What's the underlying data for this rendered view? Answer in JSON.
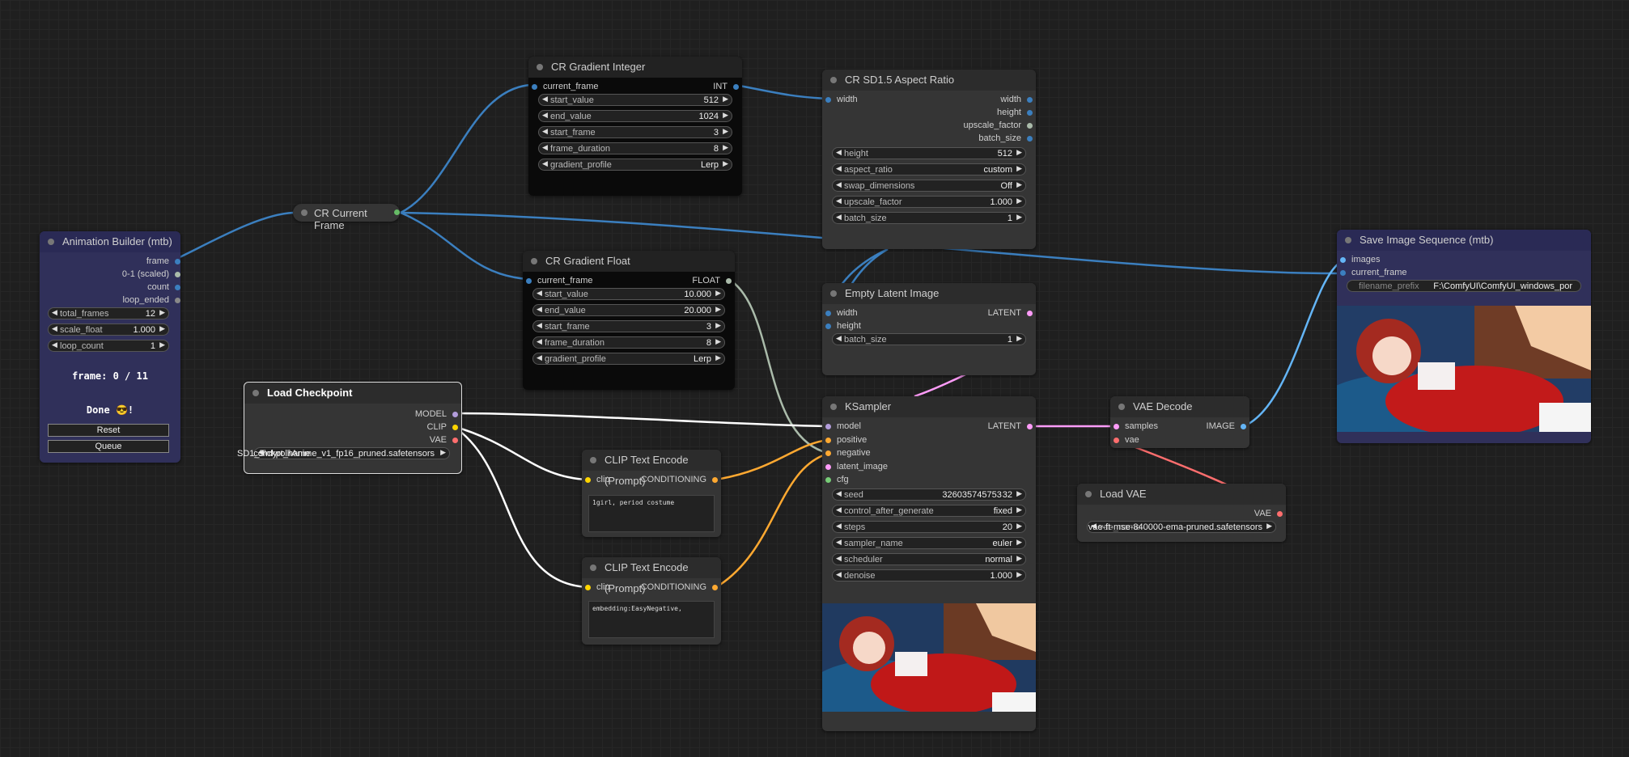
{
  "colors": {
    "model": "#b39ddb",
    "clip": "#ffd500",
    "vae": "#ff6e6e",
    "latent": "#ff9cf9",
    "conditioning": "#ffa931",
    "image": "#64b5f6",
    "int": "#3b7fbf",
    "float": "#aabbaa"
  },
  "anim": {
    "title": "Animation Builder (mtb)",
    "outputs": [
      "frame",
      "0-1 (scaled)",
      "count",
      "loop_ended"
    ],
    "widgets": [
      {
        "label": "total_frames",
        "value": "12"
      },
      {
        "label": "scale_float",
        "value": "1.000"
      },
      {
        "label": "loop_count",
        "value": "1"
      }
    ],
    "frame_text": "frame: 0 / 11",
    "done_text": "Done 😎!",
    "reset": "Reset",
    "queue": "Queue"
  },
  "current_frame": {
    "title": "CR Current Frame"
  },
  "grad_int": {
    "title": "CR Gradient Integer",
    "input": "current_frame",
    "output": "INT",
    "widgets": [
      {
        "label": "start_value",
        "value": "512"
      },
      {
        "label": "end_value",
        "value": "1024"
      },
      {
        "label": "start_frame",
        "value": "3"
      },
      {
        "label": "frame_duration",
        "value": "8"
      },
      {
        "label": "gradient_profile",
        "value": "Lerp"
      }
    ]
  },
  "grad_float": {
    "title": "CR Gradient Float",
    "input": "current_frame",
    "output": "FLOAT",
    "widgets": [
      {
        "label": "start_value",
        "value": "10.000"
      },
      {
        "label": "end_value",
        "value": "20.000"
      },
      {
        "label": "start_frame",
        "value": "3"
      },
      {
        "label": "frame_duration",
        "value": "8"
      },
      {
        "label": "gradient_profile",
        "value": "Lerp"
      }
    ]
  },
  "aspect": {
    "title": "CR SD1.5 Aspect Ratio",
    "input": "width",
    "outputs": [
      "width",
      "height",
      "upscale_factor",
      "batch_size"
    ],
    "widgets": [
      {
        "label": "height",
        "value": "512"
      },
      {
        "label": "aspect_ratio",
        "value": "custom"
      },
      {
        "label": "swap_dimensions",
        "value": "Off"
      },
      {
        "label": "upscale_factor",
        "value": "1.000"
      },
      {
        "label": "batch_size",
        "value": "1"
      }
    ]
  },
  "latent": {
    "title": "Empty Latent Image",
    "inputs": [
      "width",
      "height"
    ],
    "output": "LATENT",
    "widgets": [
      {
        "label": "batch_size",
        "value": "1"
      }
    ]
  },
  "checkpoint": {
    "title": "Load Checkpoint",
    "outputs": [
      "MODEL",
      "CLIP",
      "VAE"
    ],
    "ckpt_label": "SD1_5\\ckpt_name",
    "ckpt_value": "comfyroll\\Anime_v1_fp16_pruned.safetensors"
  },
  "clip1": {
    "title": "CLIP Text Encode (Prompt)",
    "input": "clip",
    "output": "CONDITIONING",
    "text": "1girl, period costume"
  },
  "clip2": {
    "title": "CLIP Text Encode (Prompt)",
    "input": "clip",
    "output": "CONDITIONING",
    "text": "embedding:EasyNegative,"
  },
  "ksampler": {
    "title": "KSampler",
    "inputs": [
      "model",
      "positive",
      "negative",
      "latent_image",
      "cfg"
    ],
    "output": "LATENT",
    "widgets": [
      {
        "label": "seed",
        "value": "326035745753 32"
      },
      {
        "label": "control_after_generate",
        "value": "fixed"
      },
      {
        "label": "steps",
        "value": "20"
      },
      {
        "label": "sampler_name",
        "value": "euler"
      },
      {
        "label": "scheduler",
        "value": "normal"
      },
      {
        "label": "denoise",
        "value": "1.000"
      }
    ]
  },
  "vaedecode": {
    "title": "VAE Decode",
    "inputs": [
      "samples",
      "vae"
    ],
    "output": "IMAGE"
  },
  "loadvae": {
    "title": "Load VAE",
    "output": "VAE",
    "vae_label": "vae_name",
    "vae_value": "vae-ft-mse-840000-ema-pruned.safetensors"
  },
  "save": {
    "title": "Save Image Sequence (mtb)",
    "inputs": [
      "images",
      "current_frame"
    ],
    "prefix_label": "filename_prefix",
    "prefix_value": "F:\\ComfyUI\\ComfyUI_windows_por"
  }
}
